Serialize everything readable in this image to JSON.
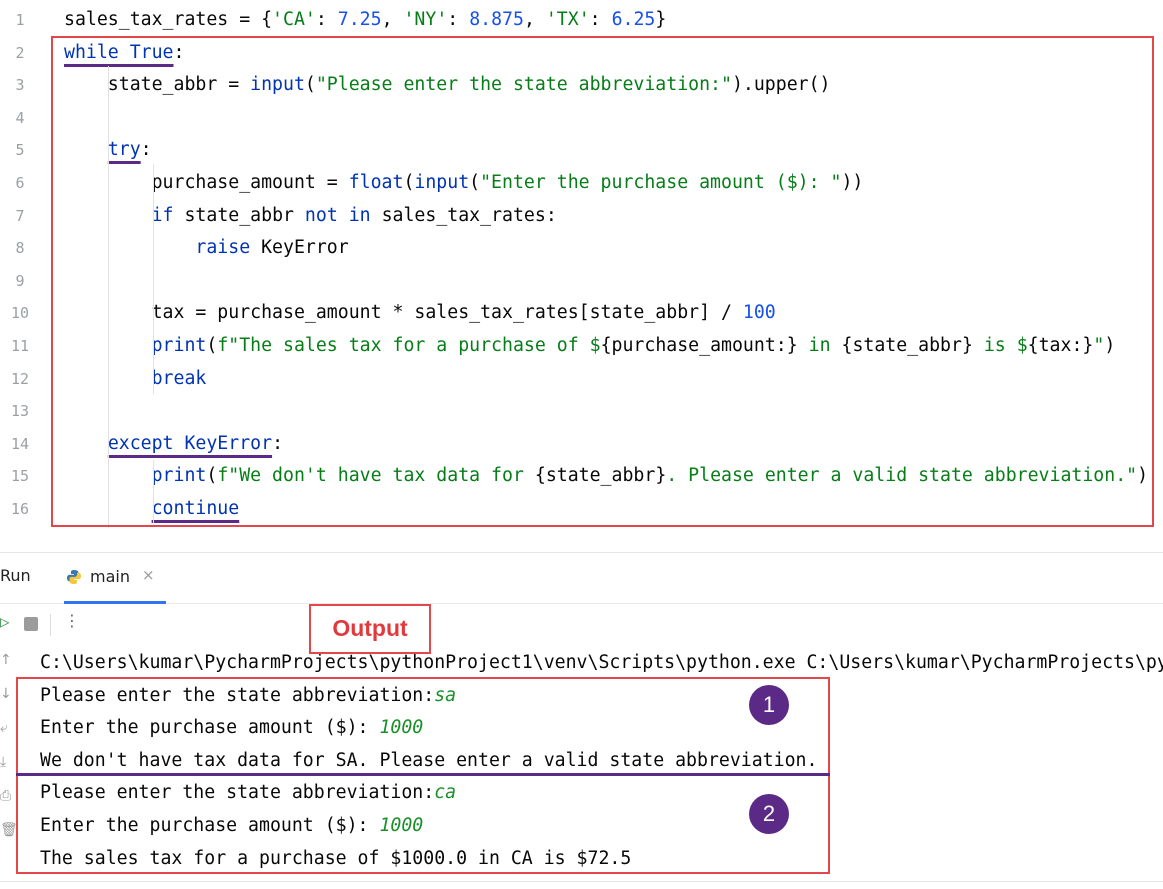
{
  "editor": {
    "line_numbers": [
      "1",
      "2",
      "3",
      "4",
      "5",
      "6",
      "7",
      "8",
      "9",
      "10",
      "11",
      "12",
      "13",
      "14",
      "15",
      "16"
    ],
    "lines": [
      [
        {
          "t": "sales_tax_rates = {"
        },
        {
          "t": "'CA'",
          "c": "str"
        },
        {
          "t": ": "
        },
        {
          "t": "7.25",
          "c": "num"
        },
        {
          "t": ", "
        },
        {
          "t": "'NY'",
          "c": "str"
        },
        {
          "t": ": "
        },
        {
          "t": "8.875",
          "c": "num"
        },
        {
          "t": ", "
        },
        {
          "t": "'TX'",
          "c": "str"
        },
        {
          "t": ": "
        },
        {
          "t": "6.25",
          "c": "num"
        },
        {
          "t": "}"
        }
      ],
      [
        {
          "t": "while True",
          "c": "kw ul"
        },
        {
          "t": ":"
        }
      ],
      [
        {
          "t": "    state_abbr = "
        },
        {
          "t": "input",
          "c": "kw"
        },
        {
          "t": "("
        },
        {
          "t": "\"Please enter the state abbreviation:\"",
          "c": "str"
        },
        {
          "t": ").upper()"
        }
      ],
      [
        {
          "t": ""
        }
      ],
      [
        {
          "t": "    "
        },
        {
          "t": "try",
          "c": "kw ul"
        },
        {
          "t": ":"
        }
      ],
      [
        {
          "t": "        purchase_amount = "
        },
        {
          "t": "float",
          "c": "kw"
        },
        {
          "t": "("
        },
        {
          "t": "input",
          "c": "kw"
        },
        {
          "t": "("
        },
        {
          "t": "\"Enter the purchase amount ($): \"",
          "c": "str"
        },
        {
          "t": "))"
        }
      ],
      [
        {
          "t": "        "
        },
        {
          "t": "if",
          "c": "kw"
        },
        {
          "t": " state_abbr "
        },
        {
          "t": "not in",
          "c": "kw"
        },
        {
          "t": " sales_tax_rates:"
        }
      ],
      [
        {
          "t": "            "
        },
        {
          "t": "raise",
          "c": "kw"
        },
        {
          "t": " KeyError"
        }
      ],
      [
        {
          "t": ""
        }
      ],
      [
        {
          "t": "        tax = purchase_amount * sales_tax_rates[state_abbr] / "
        },
        {
          "t": "100",
          "c": "num"
        }
      ],
      [
        {
          "t": "        "
        },
        {
          "t": "print",
          "c": "kw"
        },
        {
          "t": "("
        },
        {
          "t": "f\"The sales tax for a purchase of $",
          "c": "str"
        },
        {
          "t": "{"
        },
        {
          "t": "purchase_amount:"
        },
        {
          "t": "}"
        },
        {
          "t": " in ",
          "c": "str"
        },
        {
          "t": "{"
        },
        {
          "t": "state_abbr"
        },
        {
          "t": "}"
        },
        {
          "t": " is $",
          "c": "str"
        },
        {
          "t": "{"
        },
        {
          "t": "tax:"
        },
        {
          "t": "}"
        },
        {
          "t": "\"",
          "c": "str"
        },
        {
          "t": ")"
        }
      ],
      [
        {
          "t": "        "
        },
        {
          "t": "break",
          "c": "kw"
        }
      ],
      [
        {
          "t": ""
        }
      ],
      [
        {
          "t": "    "
        },
        {
          "t": "except KeyError",
          "c": "kw ul"
        },
        {
          "t": ":"
        }
      ],
      [
        {
          "t": "        "
        },
        {
          "t": "print",
          "c": "kw"
        },
        {
          "t": "("
        },
        {
          "t": "f\"We don't have tax data for ",
          "c": "str"
        },
        {
          "t": "{"
        },
        {
          "t": "state_abbr"
        },
        {
          "t": "}"
        },
        {
          "t": ". Please enter a valid state abbreviation.\"",
          "c": "str"
        },
        {
          "t": ")"
        }
      ],
      [
        {
          "t": "        "
        },
        {
          "t": "continue",
          "c": "kw ul"
        }
      ]
    ]
  },
  "run_panel": {
    "label": "Run",
    "tab_label": "main",
    "close_glyph": "×",
    "more_glyph": "⋮",
    "output_badge": "Output",
    "command": "C:\\Users\\kumar\\PycharmProjects\\pythonProject1\\venv\\Scripts\\python.exe C:\\Users\\kumar\\PycharmProjects\\py",
    "console": [
      [
        {
          "t": "Please enter the state abbreviation:"
        },
        {
          "t": "sa",
          "c": "in"
        }
      ],
      [
        {
          "t": "Enter the purchase amount ($): "
        },
        {
          "t": "1000",
          "c": "in"
        }
      ],
      [
        {
          "t": "We don't have tax data for SA. Please enter a valid state abbreviation."
        }
      ],
      [
        {
          "t": "Please enter the state abbreviation:"
        },
        {
          "t": "ca",
          "c": "in"
        }
      ],
      [
        {
          "t": "Enter the purchase amount ($): "
        },
        {
          "t": "1000",
          "c": "in"
        }
      ],
      [
        {
          "t": "The sales tax for a purchase of $1000.0 in CA is $72.5"
        }
      ]
    ],
    "markers": [
      "1",
      "2"
    ]
  },
  "colors": {
    "keyword": "#0033b3",
    "string": "#067d17",
    "number": "#1750eb",
    "user_input": "#1a8f28",
    "highlight_box": "#e3474a",
    "marker": "#5b2a86",
    "tab_accent": "#3574f0"
  },
  "icons": [
    "python-file-icon",
    "close-icon",
    "rerun-icon",
    "stop-icon",
    "more-icon",
    "scroll-up-icon",
    "scroll-down-icon",
    "soft-wrap-icon",
    "scroll-to-end-icon",
    "print-icon",
    "trash-icon"
  ]
}
